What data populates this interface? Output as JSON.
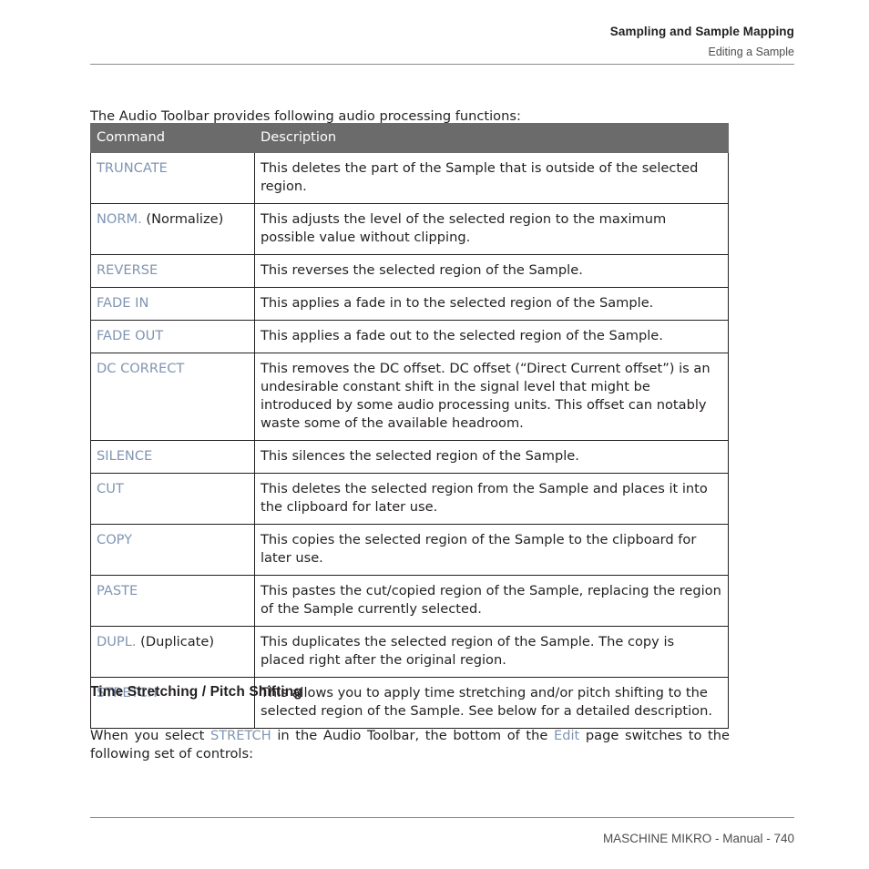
{
  "running_head": {
    "title": "Sampling and Sample Mapping",
    "subtitle": "Editing a Sample"
  },
  "intro": "The Audio Toolbar provides following audio processing functions:",
  "table": {
    "headers": {
      "command": "Command",
      "description": "Description"
    },
    "rows": [
      {
        "command": "TRUNCATE",
        "command_suffix": "",
        "description": "This deletes the part of the Sample that is outside of the selected region."
      },
      {
        "command": "NORM.",
        "command_suffix": " (Normalize)",
        "description": "This adjusts the level of the selected region to the maximum possible value without clipping."
      },
      {
        "command": "REVERSE",
        "command_suffix": "",
        "description": "This reverses the selected region of the Sample."
      },
      {
        "command": "FADE IN",
        "command_suffix": "",
        "description": "This applies a fade in to the selected region of the Sample."
      },
      {
        "command": "FADE OUT",
        "command_suffix": "",
        "description": "This applies a fade out to the selected region of the Sample."
      },
      {
        "command": "DC CORRECT",
        "command_suffix": "",
        "description": "This removes the DC offset. DC offset (“Direct Current offset”) is an undesirable constant shift in the signal level that might be introduced by some audio processing units. This offset can notably waste some of the available headroom."
      },
      {
        "command": "SILENCE",
        "command_suffix": "",
        "description": "This silences the selected region of the Sample."
      },
      {
        "command": "CUT",
        "command_suffix": "",
        "description": "This deletes the selected region from the Sample and places it into the clipboard for later use."
      },
      {
        "command": "COPY",
        "command_suffix": "",
        "description": "This copies the selected region of the Sample to the clipboard for later use."
      },
      {
        "command": "PASTE",
        "command_suffix": "",
        "description": "This pastes the cut/copied region of the Sample, replacing the region of the Sample currently selected."
      },
      {
        "command": "DUPL.",
        "command_suffix": " (Duplicate)",
        "description": "This duplicates the selected region of the Sample. The copy is placed right after the original region."
      },
      {
        "command": "STRETCH",
        "command_suffix": "",
        "description": "This allows you to apply time stretching and/or pitch shifting to the selected region of the Sample. See below for a detailed description."
      }
    ]
  },
  "section": {
    "heading": "Time Stretching / Pitch Shifting",
    "paragraph": {
      "part1": "When you select ",
      "link1": "STRETCH",
      "part2": " in the Audio Toolbar, the bottom of the ",
      "link2": "Edit",
      "part3": " page switches to the following set of controls:"
    }
  },
  "footer": {
    "text": "MASCHINE MIKRO - Manual - 740"
  },
  "colors": {
    "command_accent": "#8095b2",
    "table_header_bg": "#6b6b6b",
    "rule": "#8c8c8c",
    "text": "#231f20"
  }
}
